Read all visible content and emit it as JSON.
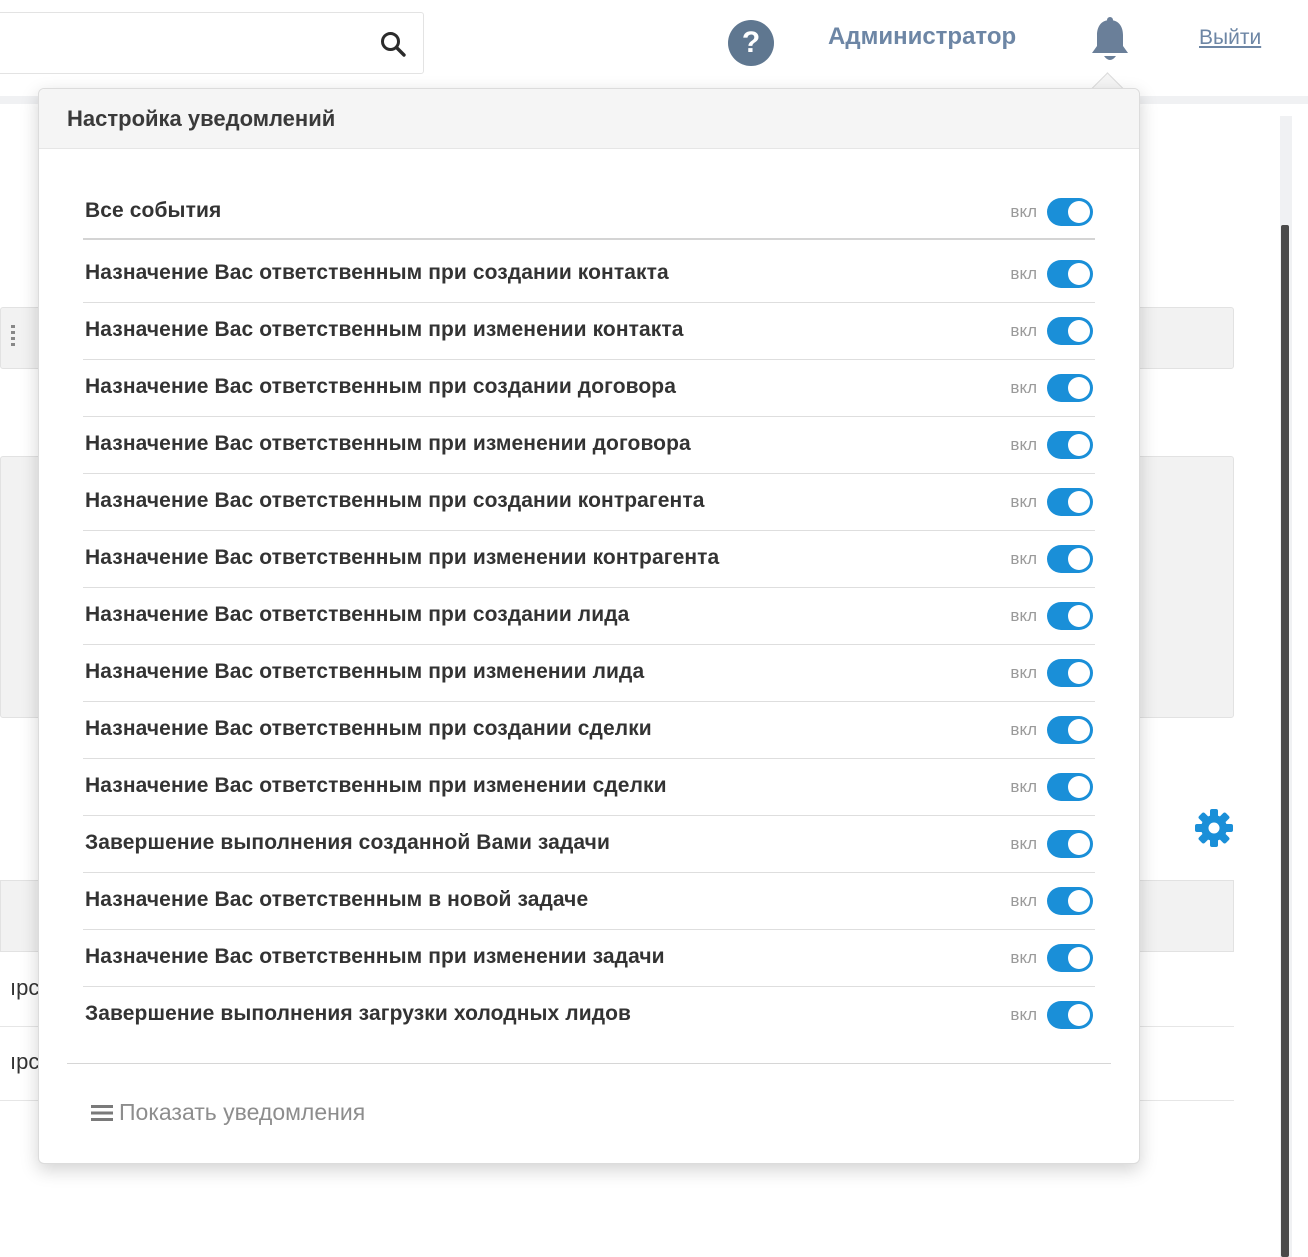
{
  "header": {
    "user_name": "Администратор",
    "logout_label": "Выйти",
    "help_symbol": "?"
  },
  "background": {
    "row_text_1": "ıрс",
    "row_text_2": "ıрс"
  },
  "popup": {
    "title": "Настройка уведомлений",
    "all_events": {
      "label": "Все события",
      "state": "вкл",
      "on": true
    },
    "items": [
      {
        "label": "Назначение Вас ответственным при создании контакта",
        "state": "вкл",
        "on": true
      },
      {
        "label": "Назначение Вас ответственным при изменении контакта",
        "state": "вкл",
        "on": true
      },
      {
        "label": "Назначение Вас ответственным при создании договора",
        "state": "вкл",
        "on": true
      },
      {
        "label": "Назначение Вас ответственным при изменении договора",
        "state": "вкл",
        "on": true
      },
      {
        "label": "Назначение Вас ответственным при создании контрагента",
        "state": "вкл",
        "on": true
      },
      {
        "label": "Назначение Вас ответственным при изменении контрагента",
        "state": "вкл",
        "on": true
      },
      {
        "label": "Назначение Вас ответственным при создании лида",
        "state": "вкл",
        "on": true
      },
      {
        "label": "Назначение Вас ответственным при изменении лида",
        "state": "вкл",
        "on": true
      },
      {
        "label": "Назначение Вас ответственным при создании сделки",
        "state": "вкл",
        "on": true
      },
      {
        "label": "Назначение Вас ответственным при изменении сделки",
        "state": "вкл",
        "on": true
      },
      {
        "label": "Завершение выполнения созданной Вами задачи",
        "state": "вкл",
        "on": true
      },
      {
        "label": "Назначение Вас ответственным в новой задаче",
        "state": "вкл",
        "on": true
      },
      {
        "label": "Назначение Вас ответственным при изменении задачи",
        "state": "вкл",
        "on": true
      },
      {
        "label": "Завершение выполнения загрузки холодных лидов",
        "state": "вкл",
        "on": true
      }
    ],
    "show_notifications_label": "Показать уведомления"
  },
  "colors": {
    "toggle_on": "#1a8fd8",
    "header_link": "#6d86a5",
    "help_icon_bg": "#5f7790"
  }
}
